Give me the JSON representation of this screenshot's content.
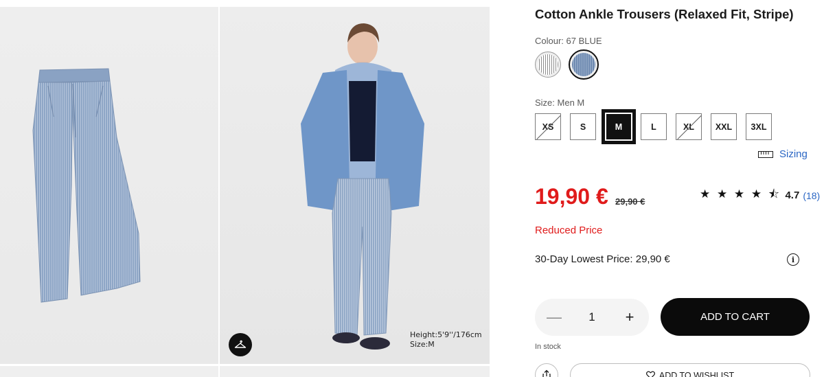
{
  "product": {
    "title": "Cotton Ankle Trousers (Relaxed Fit, Stripe)",
    "colour_label": "Colour: 67 BLUE",
    "colours": [
      {
        "name": "white-stripe",
        "color": "#d9d9d9"
      },
      {
        "name": "67 BLUE",
        "color": "#7f97bb",
        "selected": true
      }
    ],
    "size_label": "Size: Men M",
    "sizes": [
      {
        "label": "XS",
        "available": false
      },
      {
        "label": "S",
        "available": true
      },
      {
        "label": "M",
        "available": true,
        "selected": true
      },
      {
        "label": "L",
        "available": true
      },
      {
        "label": "XL",
        "available": false
      },
      {
        "label": "XXL",
        "available": true
      },
      {
        "label": "3XL",
        "available": true
      }
    ],
    "sizing_link": "Sizing",
    "price": "19,90 €",
    "original_price": "29,90 €",
    "rating": {
      "stars": "★ ★ ★ ★ ⯪",
      "score": "4.7",
      "count": "(18)",
      "value": 4.7
    },
    "reduced_label": "Reduced Price",
    "lowest_price": "30-Day Lowest Price: 29,90 €",
    "quantity": {
      "minus": "—",
      "value": "1",
      "plus": "+"
    },
    "add_to_cart": "ADD TO CART",
    "stock": "In stock",
    "wishlist": "ADD TO WISHLIST"
  },
  "gallery": {
    "model_height": "Height:5'9''/176cm",
    "model_size": "Size:M"
  },
  "colors": {
    "price_red": "#e01b1b",
    "link_blue": "#2a66c4",
    "denim": "#8fa7c9"
  }
}
